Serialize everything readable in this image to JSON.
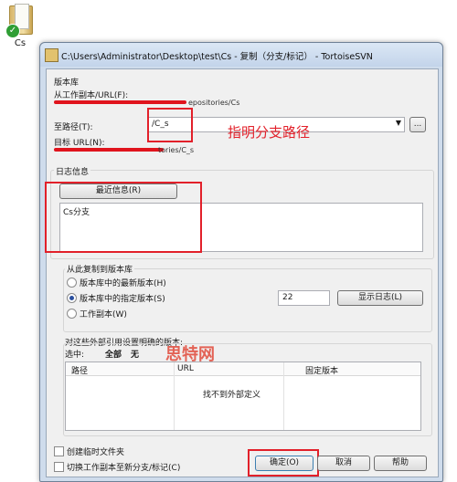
{
  "desktop": {
    "icon_label": "Cs"
  },
  "window": {
    "title": "C:\\Users\\Administrator\\Desktop\\test\\Cs - 复制（分支/标记） - TortoiseSVN"
  },
  "repository": {
    "group_title": "版本库",
    "from_label": "从工作副本/URL(F):",
    "from_value_fragment": "epositories/Cs",
    "to_path_label": "至路径(T):",
    "to_path_value": "/C_s",
    "browse_label": "...",
    "target_url_label": "目标 URL(N):",
    "target_url_fragment": "tories/C_s"
  },
  "log": {
    "group_title": "日志信息",
    "recent_button": "最近信息(R)",
    "message": "Cs分支"
  },
  "copy_from": {
    "group_title": "从此复制到版本库",
    "options": [
      {
        "label": "版本库中的最新版本(H)",
        "selected": false
      },
      {
        "label": "版本库中的指定版本(S)",
        "selected": true
      },
      {
        "label": "工作副本(W)",
        "selected": false
      }
    ],
    "revision_value": "22",
    "show_log_button": "显示日志(L)"
  },
  "externals": {
    "group_title": "对这些外部引用设置明确的版本:",
    "select_label": "选中:",
    "select_all": "全部",
    "select_none": "无",
    "columns": [
      "路径",
      "URL",
      "固定版本"
    ],
    "empty_message": "找不到外部定义"
  },
  "options": {
    "create_intermediate": "创建临时文件夹",
    "switch_working_copy": "切换工作副本至新分支/标记(C)"
  },
  "buttons": {
    "ok": "确定(O)",
    "cancel": "取消",
    "help": "帮助"
  },
  "annotations": {
    "branch_path_note": "指明分支路径",
    "watermark_text": "思特网"
  },
  "colors": {
    "annotation_red": "#e2202a",
    "accent_blue": "#2a4f9e"
  }
}
